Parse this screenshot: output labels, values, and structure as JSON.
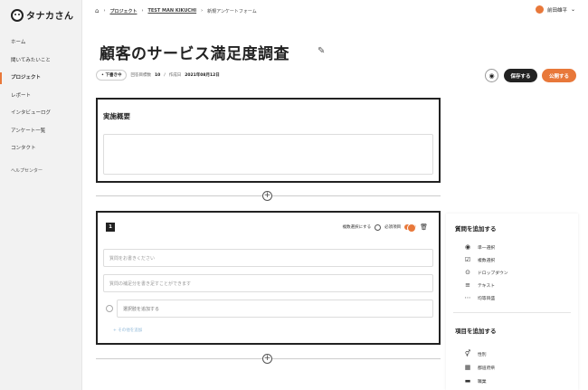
{
  "app": {
    "logo_text": "タナカさん"
  },
  "sidebar": {
    "items": [
      {
        "label": "ホーム"
      },
      {
        "label": "聞いてみたいこと"
      },
      {
        "label": "プロジェクト"
      },
      {
        "label": "レポート"
      },
      {
        "label": "インタビューログ"
      },
      {
        "label": "アンケート一覧"
      },
      {
        "label": "コンタクト"
      }
    ],
    "help": "ヘルプセンター",
    "active_index": 2
  },
  "header": {
    "breadcrumbs": [
      "プロジェクト",
      "TEST MAN KIKUCHI",
      "新規アンケートフォーム"
    ],
    "user_name": "前田雄平"
  },
  "form": {
    "title": "顧客のサービス満足度調査",
    "status": "下書き中",
    "meta_target_label": "回答目標数",
    "meta_target_value": "10",
    "meta_date_label": "作成日",
    "meta_date_value": "2021年08月12日",
    "save_label": "保存する",
    "publish_label": "公開する"
  },
  "section1": {
    "title": "実施概要"
  },
  "question": {
    "number": "1",
    "multi_label": "複数選択にする",
    "required_label": "必須項目",
    "required_on": true,
    "question_placeholder": "質問をお書きください",
    "note_placeholder": "質問の補足分を書き足すことができます",
    "option_placeholder": "選択肢を追加する",
    "add_other": "その他を追加"
  },
  "panel": {
    "add_question_title": "質問を追加する",
    "question_types": [
      {
        "label": "単一選択",
        "icon": "radio-icon"
      },
      {
        "label": "複数選択",
        "icon": "checkbox-icon"
      },
      {
        "label": "ドロップダウン",
        "icon": "dropdown-icon"
      },
      {
        "label": "テキスト",
        "icon": "text-icon"
      },
      {
        "label": "均等目盛",
        "icon": "scale-icon"
      }
    ],
    "add_item_title": "項目を追加する",
    "item_types": [
      {
        "label": "性別",
        "icon": "gender-icon"
      },
      {
        "label": "都道府県",
        "icon": "map-icon"
      },
      {
        "label": "職業",
        "icon": "briefcase-icon"
      }
    ]
  },
  "colors": {
    "accent": "#e8783a",
    "dark": "#222222"
  }
}
